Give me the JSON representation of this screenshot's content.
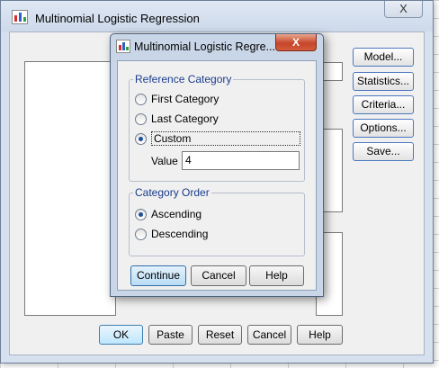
{
  "main_dialog": {
    "title": "Multinomial Logistic Regression",
    "close_label": "X",
    "side_buttons": [
      {
        "name": "model-button",
        "label": "Model..."
      },
      {
        "name": "statistics-button",
        "label": "Statistics..."
      },
      {
        "name": "criteria-button",
        "label": "Criteria..."
      },
      {
        "name": "options-button",
        "label": "Options..."
      },
      {
        "name": "save-button",
        "label": "Save..."
      }
    ],
    "bottom_buttons": [
      {
        "name": "ok-button",
        "label": "OK"
      },
      {
        "name": "paste-button",
        "label": "Paste"
      },
      {
        "name": "reset-button",
        "label": "Reset"
      },
      {
        "name": "cancel-button",
        "label": "Cancel"
      },
      {
        "name": "help-button",
        "label": "Help"
      }
    ]
  },
  "sub_dialog": {
    "title": "Multinomial Logistic Regre...",
    "close_label": "X",
    "reference_category": {
      "legend": "Reference Category",
      "options": [
        "First Category",
        "Last Category",
        "Custom"
      ],
      "selected": "Custom",
      "value_label": "Value",
      "value": "4"
    },
    "category_order": {
      "legend": "Category Order",
      "options": [
        "Ascending",
        "Descending"
      ],
      "selected": "Ascending"
    },
    "buttons": {
      "continue": "Continue",
      "cancel": "Cancel",
      "help": "Help"
    }
  },
  "colors": {
    "title_bar": "#d6e0ee",
    "group_legend": "#1a3c8c",
    "close_button": "#c6462a",
    "focus_border": "#4a78c0"
  },
  "icons": {
    "app": "spss-table-icon"
  }
}
